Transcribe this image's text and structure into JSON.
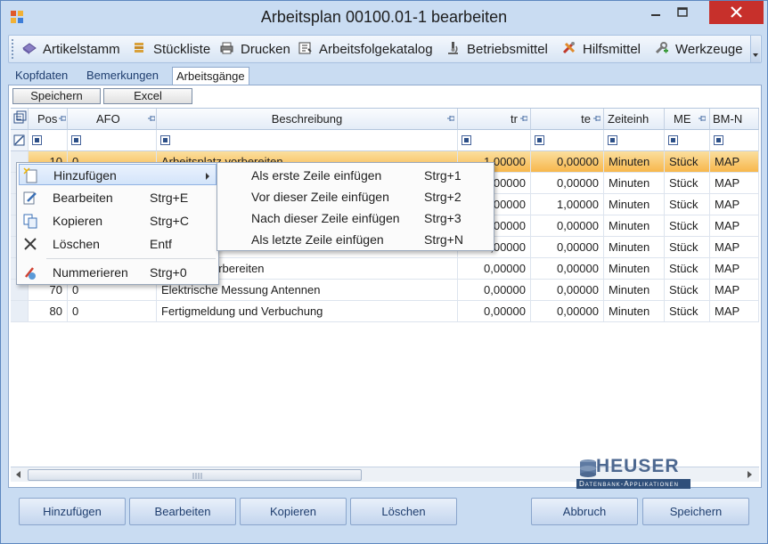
{
  "window": {
    "title": "Arbeitsplan 00100.01-1 bearbeiten",
    "colors": {
      "title_bg": "#c9dcf2",
      "close_bg": "#c7302b",
      "selection": "#f7b74c",
      "border": "#5d87bf"
    }
  },
  "toolbar": {
    "items": [
      {
        "label": "Artikelstamm",
        "icon": "gem-icon"
      },
      {
        "label": "Stückliste",
        "icon": "stacked-list-icon"
      },
      {
        "label": "Drucken",
        "icon": "printer-icon"
      },
      {
        "label": "Arbeitsfolgekatalog",
        "icon": "catalog-icon"
      },
      {
        "label": "Betriebsmittel",
        "icon": "microscope-icon"
      },
      {
        "label": "Hilfsmittel",
        "icon": "tools-icon"
      },
      {
        "label": "Werkzeuge",
        "icon": "wrench-icon"
      }
    ]
  },
  "tabs": [
    {
      "label": "Kopfdaten"
    },
    {
      "label": "Bemerkungen"
    },
    {
      "label": "Arbeitsgänge",
      "active": true
    }
  ],
  "panel_buttons": {
    "save": "Speichern",
    "excel": "Excel"
  },
  "grid": {
    "columns": [
      "Pos",
      "AFO",
      "Beschreibung",
      "tr",
      "te",
      "Zeiteinh",
      "ME",
      "BM-N"
    ],
    "rows": [
      {
        "pos": "10",
        "afo": "0",
        "desc": "Arbeitsplatz vorbereiten",
        "tr": "1,00000",
        "te": "0,00000",
        "unit": "Minuten",
        "me": "Stück",
        "bm": "MAP",
        "selected": true
      },
      {
        "pos": "",
        "afo": "",
        "desc": "",
        "tr": "0,00000",
        "te": "0,00000",
        "unit": "Minuten",
        "me": "Stück",
        "bm": "MAP"
      },
      {
        "pos": "",
        "afo": "",
        "desc": "",
        "tr": "0,00000",
        "te": "1,00000",
        "unit": "Minuten",
        "me": "Stück",
        "bm": "MAP"
      },
      {
        "pos": "",
        "afo": "",
        "desc": "",
        "tr": "0,00000",
        "te": "0,00000",
        "unit": "Minuten",
        "me": "Stück",
        "bm": "MAP"
      },
      {
        "pos": "",
        "afo": "",
        "desc": "",
        "tr": "0,00000",
        "te": "0,00000",
        "unit": "Minuten",
        "me": "Stück",
        "bm": "MAP"
      },
      {
        "pos": "",
        "afo": "",
        "desc": "orbereiten",
        "tr": "0,00000",
        "te": "0,00000",
        "unit": "Minuten",
        "me": "Stück",
        "bm": "MAP"
      },
      {
        "pos": "70",
        "afo": "0",
        "desc": "Elektrische Messung Antennen",
        "tr": "0,00000",
        "te": "0,00000",
        "unit": "Minuten",
        "me": "Stück",
        "bm": "MAP"
      },
      {
        "pos": "80",
        "afo": "0",
        "desc": "Fertigmeldung und Verbuchung",
        "tr": "0,00000",
        "te": "0,00000",
        "unit": "Minuten",
        "me": "Stück",
        "bm": "MAP"
      }
    ]
  },
  "context_menu": {
    "items": [
      {
        "label": "Hinzufügen",
        "shortcut": "",
        "icon": "add-page-icon"
      },
      {
        "label": "Bearbeiten",
        "shortcut": "Strg+E",
        "icon": "edit-icon"
      },
      {
        "label": "Kopieren",
        "shortcut": "Strg+C",
        "icon": "copy-icon"
      },
      {
        "label": "Löschen",
        "shortcut": "Entf",
        "icon": "delete-x-icon"
      },
      {
        "label": "Nummerieren",
        "shortcut": "Strg+0",
        "icon": "renumber-icon"
      }
    ]
  },
  "submenu": {
    "items": [
      {
        "label": "Als erste Zeile einfügen",
        "shortcut": "Strg+1"
      },
      {
        "label": "Vor dieser Zeile einfügen",
        "shortcut": "Strg+2"
      },
      {
        "label": "Nach dieser Zeile einfügen",
        "shortcut": "Strg+3"
      },
      {
        "label": "Als letzte Zeile einfügen",
        "shortcut": "Strg+N"
      }
    ]
  },
  "logo": {
    "brand": "HEUSER",
    "tagline": "Datenbank-Applikationen"
  },
  "footer": {
    "add": "Hinzufügen",
    "edit": "Bearbeiten",
    "copy": "Kopieren",
    "delete": "Löschen",
    "cancel": "Abbruch",
    "save": "Speichern"
  }
}
